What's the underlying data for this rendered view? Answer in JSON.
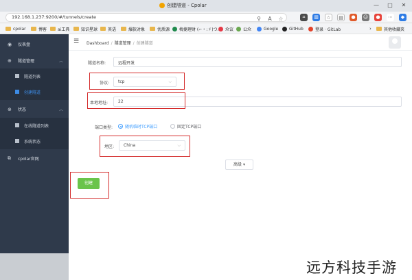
{
  "browser": {
    "tab_title": "创建隧道 - Cpolar",
    "url": "192.168.1.237:9200/#/tunnels/create",
    "window_controls": [
      "—",
      "□",
      "✕"
    ],
    "bookmarks": [
      {
        "label": "cpolar",
        "kind": "folder"
      },
      {
        "label": "博客",
        "kind": "folder"
      },
      {
        "label": "ai工具",
        "kind": "folder"
      },
      {
        "label": "知识星球",
        "kind": "folder"
      },
      {
        "label": "英语",
        "kind": "folder"
      },
      {
        "label": "爆款对象",
        "kind": "folder"
      },
      {
        "label": "优质源",
        "kind": "folder"
      },
      {
        "label": "梅捷理财 (⌐・:ゞ)つ...",
        "kind": "site"
      },
      {
        "label": "众议",
        "kind": "site"
      },
      {
        "label": "公众",
        "kind": "site"
      },
      {
        "label": "Google",
        "kind": "site"
      },
      {
        "label": "GitHub",
        "kind": "site"
      },
      {
        "label": "登录 · GitLab",
        "kind": "site"
      },
      {
        "label": "其他收藏夹",
        "kind": "folder"
      }
    ]
  },
  "sidebar": {
    "items": [
      {
        "label": "仪表盘",
        "icon": "dashboard-icon"
      },
      {
        "label": "隧道管理",
        "icon": "plus-circle-icon"
      },
      {
        "label": "隧道列表",
        "icon": "list-icon"
      },
      {
        "label": "创建隧道",
        "icon": "list-icon"
      },
      {
        "label": "状态",
        "icon": "plus-circle-icon"
      },
      {
        "label": "在线隧道列表",
        "icon": "list-icon"
      },
      {
        "label": "系统状态",
        "icon": "list-icon"
      },
      {
        "label": "cpolar官网",
        "icon": "external-link-icon"
      }
    ]
  },
  "header": {
    "breadcrumb": [
      "Dashboard",
      "隧道管理",
      "创建隧道"
    ]
  },
  "form": {
    "tunnel_name_label": "隧道名称:",
    "tunnel_name_value": "远程开发",
    "protocol_label": "协议:",
    "protocol_value": "tcp",
    "local_address_label": "本地地址:",
    "local_address_value": "22",
    "port_type_label": "端口类型:",
    "port_type_options": [
      "随机临时TCP端口",
      "固定TCP端口"
    ],
    "port_type_selected": "随机临时TCP端口",
    "region_label": "地区:",
    "region_value": "China",
    "advanced_label": "高级 ▾",
    "create_button": "创建"
  },
  "watermark": "远方科技手游",
  "colors": {
    "sidebar_bg": "#2f3a4b",
    "active_blue": "#3d8ce6",
    "create_green": "#6ac44a",
    "highlight_red": "#d42a2a"
  }
}
